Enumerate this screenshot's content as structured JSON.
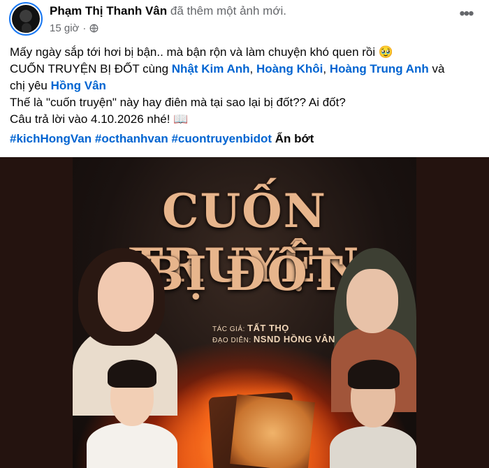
{
  "post": {
    "author_name": "Phạm Thị Thanh Vân",
    "action_text": "đã thêm một ảnh mới.",
    "time": "15 giờ",
    "privacy_icon": "globe-icon",
    "more_icon": "more-dots-icon"
  },
  "text": {
    "line1": "Mấy ngày sắp tới hơi bị bận.. mà bận rộn và làm chuyện khó quen rồi 🥹",
    "line2_prefix": "CUỐN TRUYỆN BỊ ĐỐT cùng ",
    "mention1": "Nhật Kim Anh",
    "sep1": ", ",
    "mention2": "Hoàng Khôi",
    "sep2": ", ",
    "mention3": "Hoàng Trung Anh",
    "line2_suffix": " và",
    "line3_prefix": "chị yêu ",
    "mention4": "Hồng Vân",
    "line4": "Thế là \"cuốn truyện\" này hay điên mà tại sao lại bị đốt?? Ai đốt?",
    "line5": "Câu trả lời vào 4.10.2026 nhé! 📖"
  },
  "hashtags": [
    "#kichHongVan",
    "#octhanhvan",
    "#cuontruyenbidot"
  ],
  "see_less": "Ẩn bớt",
  "poster": {
    "title_line1": "CUỐN TRUYỆN",
    "title_line2": "BỊ ĐỐT",
    "author_label": "TÁC GIẢ:",
    "author": "TẤT THỌ",
    "director_label": "ĐẠO DIỄN:",
    "director": "NSND HỒNG VÂN"
  },
  "colors": {
    "link": "#0064d1",
    "secondary_text": "#65676b",
    "poster_title": "#e7b58c"
  }
}
